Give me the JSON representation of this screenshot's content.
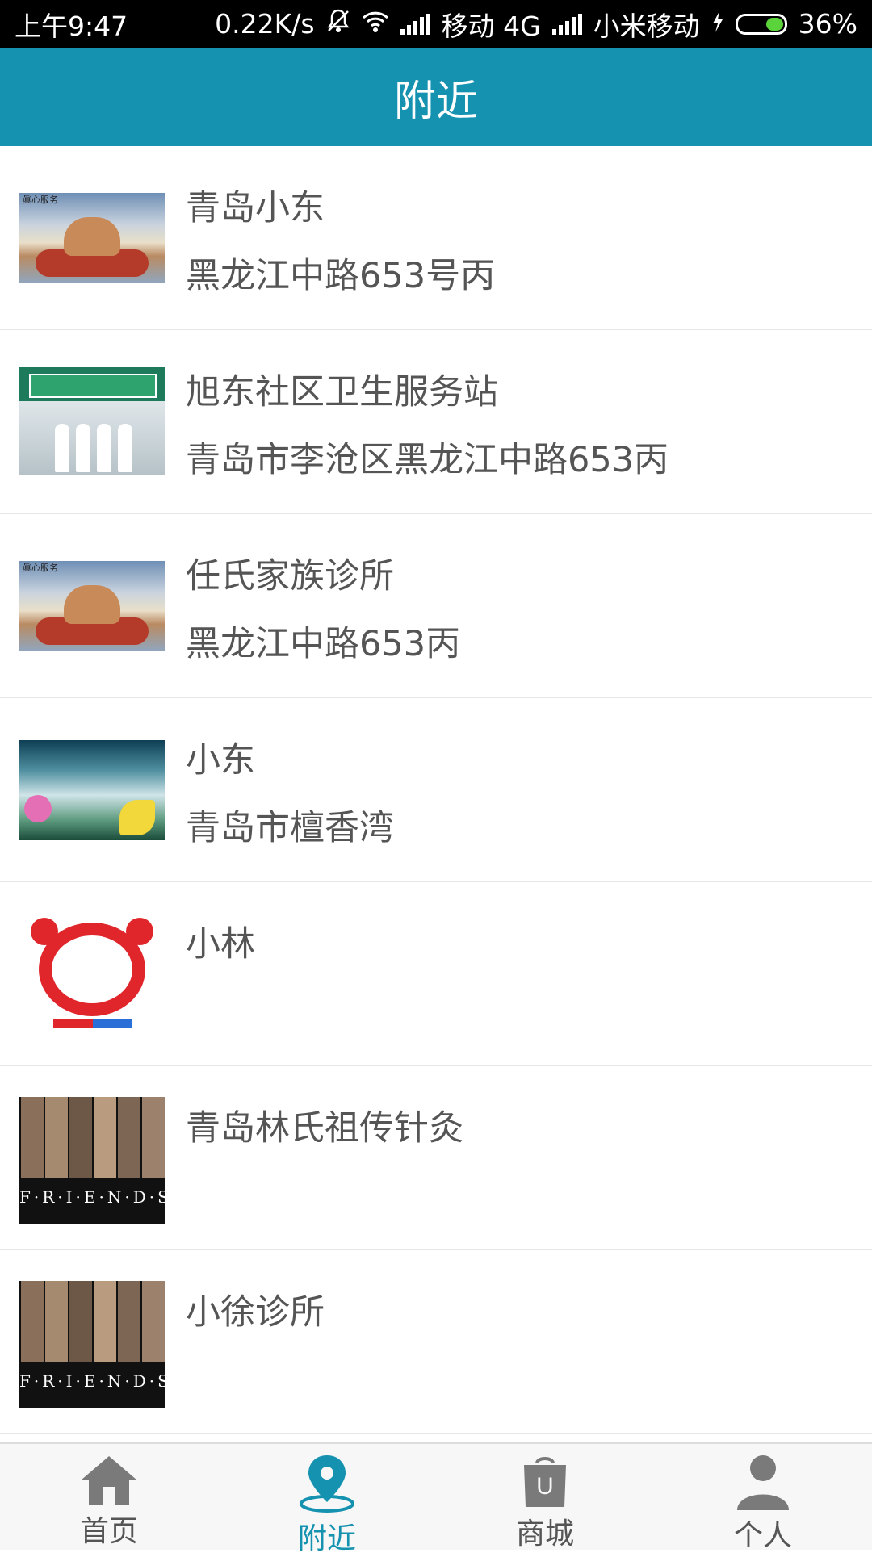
{
  "status_bar": {
    "time": "上午9:47",
    "speed": "0.22K/s",
    "carrier1": "移动 4G",
    "carrier2": "小米移动",
    "battery": "36%",
    "battery_level": 0.36
  },
  "header": {
    "title": "附近"
  },
  "items": [
    {
      "title": "青岛小东",
      "address": "黑龙江中路653号丙",
      "thumbnail": "hands-image"
    },
    {
      "title": "旭东社区卫生服务站",
      "address": "青岛市李沧区黑龙江中路653丙",
      "thumbnail": "clinic-photo"
    },
    {
      "title": "任氏家族诊所",
      "address": "黑龙江中路653丙",
      "thumbnail": "hands-image"
    },
    {
      "title": "小东",
      "address": "青岛市檀香湾",
      "thumbnail": "scenic-image"
    },
    {
      "title": "小林",
      "address": "",
      "thumbnail": "red-ring-logo"
    },
    {
      "title": "青岛林氏祖传针灸",
      "address": "",
      "thumbnail": "friends-poster"
    },
    {
      "title": "小徐诊所",
      "address": "",
      "thumbnail": "friends-poster"
    }
  ],
  "tabs": [
    {
      "label": "首页",
      "icon": "home-icon",
      "active": false
    },
    {
      "label": "附近",
      "icon": "location-pin-icon",
      "active": true
    },
    {
      "label": "商城",
      "icon": "shopping-bag-icon",
      "active": false
    },
    {
      "label": "个人",
      "icon": "person-icon",
      "active": false
    }
  ],
  "colors": {
    "accent": "#1492b0",
    "inactive_icon": "#7a7a7a",
    "text": "#555555"
  }
}
